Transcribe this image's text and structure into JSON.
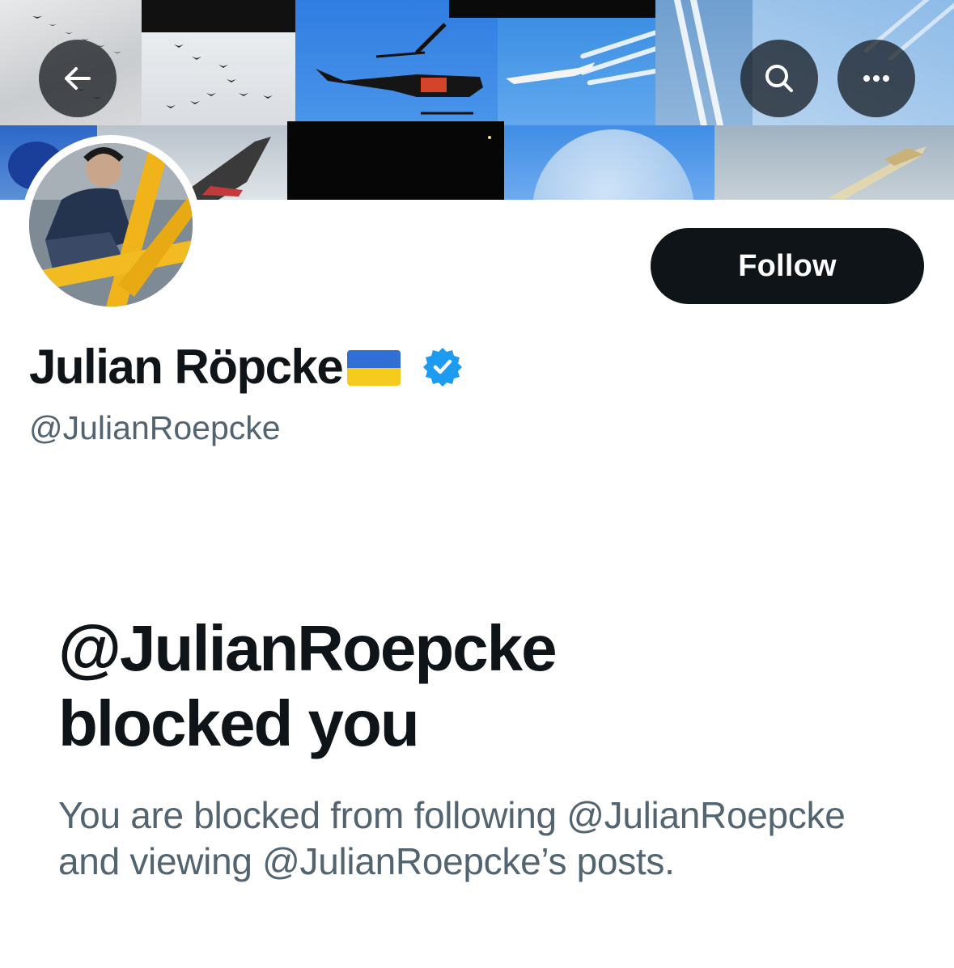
{
  "header": {
    "back_icon": "arrow-left-icon",
    "search_icon": "search-icon",
    "more_icon": "more-horizontal-icon"
  },
  "profile": {
    "display_name": "Julian Röpcke",
    "flag_icon": "ukraine-flag-icon",
    "verified_icon": "verified-badge-icon",
    "handle": "@JulianRoepcke",
    "follow_label": "Follow"
  },
  "blocked_notice": {
    "title_line1": "@JulianRoepcke",
    "title_line2": "blocked you",
    "description_line1": "You are blocked from following @JulianRoepcke",
    "description_line2": "and viewing @JulianRoepcke’s posts."
  },
  "colors": {
    "text_primary": "#0f1419",
    "text_secondary": "#536471",
    "verified_blue": "#1d9bf0",
    "button_dark": "#0f1419"
  }
}
